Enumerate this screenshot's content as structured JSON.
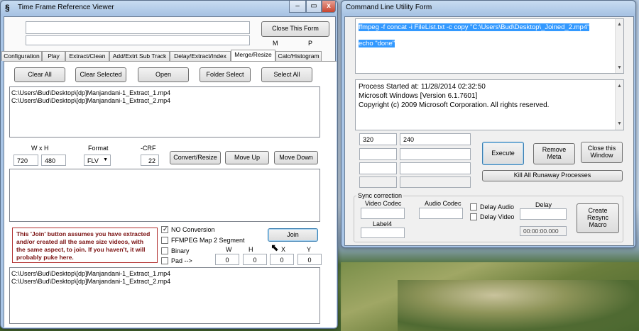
{
  "left_window": {
    "title": "Time Frame Reference Viewer",
    "close_form_button": "Close This Form",
    "m_label": "M",
    "p_label": "P",
    "tabs": [
      "Configuration",
      "Play",
      "Extract/Clean",
      "Add/Extrt Sub Track",
      "Delay/Extract/Index",
      "Merge/Resize",
      "Calc/Histogram"
    ],
    "active_tab": "Merge/Resize",
    "buttons": {
      "clear_all": "Clear All",
      "clear_selected": "Clear Selected",
      "open": "Open",
      "folder_select": "Folder Select",
      "select_all": "Select All",
      "convert_resize": "Convert/Resize",
      "move_up": "Move Up",
      "move_down": "Move Down",
      "join": "Join"
    },
    "file_list": [
      "C:\\Users\\Bud\\Desktop\\[dp]Manjandani-1_Extract_1.mp4",
      "C:\\Users\\Bud\\Desktop\\[dp]Manjandani-1_Extract_2.mp4"
    ],
    "labels": {
      "wxh": "W x H",
      "format": "Format",
      "crf": "-CRF",
      "w": "W",
      "h": "H",
      "x": "X",
      "y": "Y",
      "pad": "Pad  -->"
    },
    "values": {
      "width": "720",
      "height": "480",
      "format": "FLV",
      "crf": "22",
      "pad_w": "0",
      "pad_h": "0",
      "pad_x": "0",
      "pad_y": "0"
    },
    "note": "This 'Join' button assumes you have extracted  and/or created all the same size videos, with the same aspect,  to join.  If you haven't,  it will probably puke here.",
    "checkboxes": [
      {
        "label": "NO Conversion",
        "checked": true
      },
      {
        "label": "FFMPEG Map 2 Segment",
        "checked": false
      },
      {
        "label": "Binary",
        "checked": false
      }
    ],
    "output_list": [
      "C:\\Users\\Bud\\Desktop\\[dp]Manjandani-1_Extract_1.mp4",
      "C:\\Users\\Bud\\Desktop\\[dp]Manjandani-1_Extract_2.mp4"
    ]
  },
  "right_window": {
    "title": "Command Line Utility Form",
    "command_line_1": "ffmpeg -f concat -i FileList.txt -c copy \"C:\\Users\\Bud\\Desktop\\_Joined_2.mp4\"",
    "command_line_2": "echo \"done\"",
    "output_lines": [
      "Process Started at: 11/28/2014 02:32:50",
      "Microsoft Windows [Version 6.1.7601]",
      "Copyright (c) 2009 Microsoft Corporation.  All rights reserved."
    ],
    "width_value": "320",
    "height_value": "240",
    "buttons": {
      "execute": "Execute",
      "remove_meta": "Remove Meta",
      "close_window": "Close this Window",
      "kill": "Kill All Runaway Processes",
      "create_resync": "Create Resync Macro"
    },
    "sync": {
      "group_label": "Sync correction",
      "video_codec": "Video Codec",
      "audio_codec": "Audio Codec",
      "label4": "Label4",
      "delay_audio": "Delay Audio",
      "delay_video": "Delay Video",
      "delay": "Delay",
      "delay_time": "00:00:00.000"
    }
  }
}
